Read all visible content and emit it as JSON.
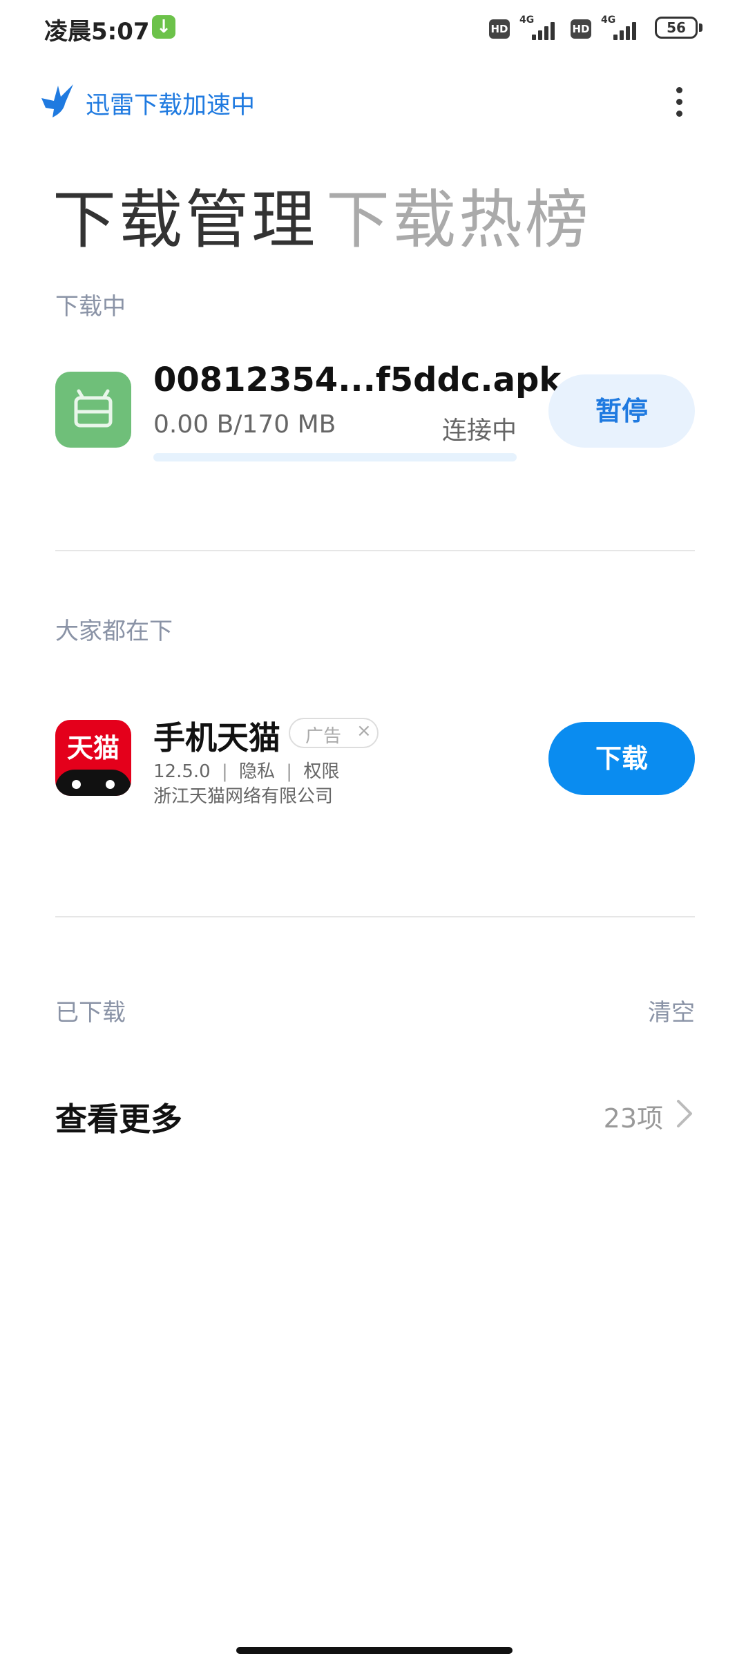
{
  "status_bar": {
    "time": "凌晨5:07",
    "sim1_hd": "HD",
    "sim1_network": "4G",
    "sim2_hd": "HD",
    "sim2_network": "4G",
    "battery": "56"
  },
  "app_bar": {
    "brand_title": "迅雷下载加速中",
    "brand_icon": "xunlei-bird-icon",
    "menu_icon": "more-vertical-icon"
  },
  "tabs": [
    {
      "label": "下载管理",
      "active": true
    },
    {
      "label": "下载热榜",
      "active": false
    }
  ],
  "downloading": {
    "section_label": "下载中",
    "item": {
      "file_name": "00812354...f5ddc.apk",
      "size_text": "0.00 B/170 MB",
      "status": "连接中",
      "progress": 0,
      "action_label": "暂停",
      "icon": "android-icon"
    }
  },
  "recommended": {
    "section_label": "大家都在下",
    "app": {
      "name": "手机天猫",
      "icon_text": "天猫",
      "ad_tag": "广告",
      "ad_close": "×",
      "version": "12.5.0",
      "privacy": "隐私",
      "permissions": "权限",
      "separator": "|",
      "developer": "浙江天猫网络有限公司",
      "action_label": "下载"
    }
  },
  "downloaded": {
    "section_label": "已下载",
    "clear_label": "清空",
    "more_label": "查看更多",
    "count": "23项"
  },
  "colors": {
    "accent": "#1f7ae0",
    "download_button": "#0a8cf0",
    "pause_button_bg": "#e8f2fd",
    "tmall_red": "#e4001b",
    "android_green": "#6fbf79"
  }
}
